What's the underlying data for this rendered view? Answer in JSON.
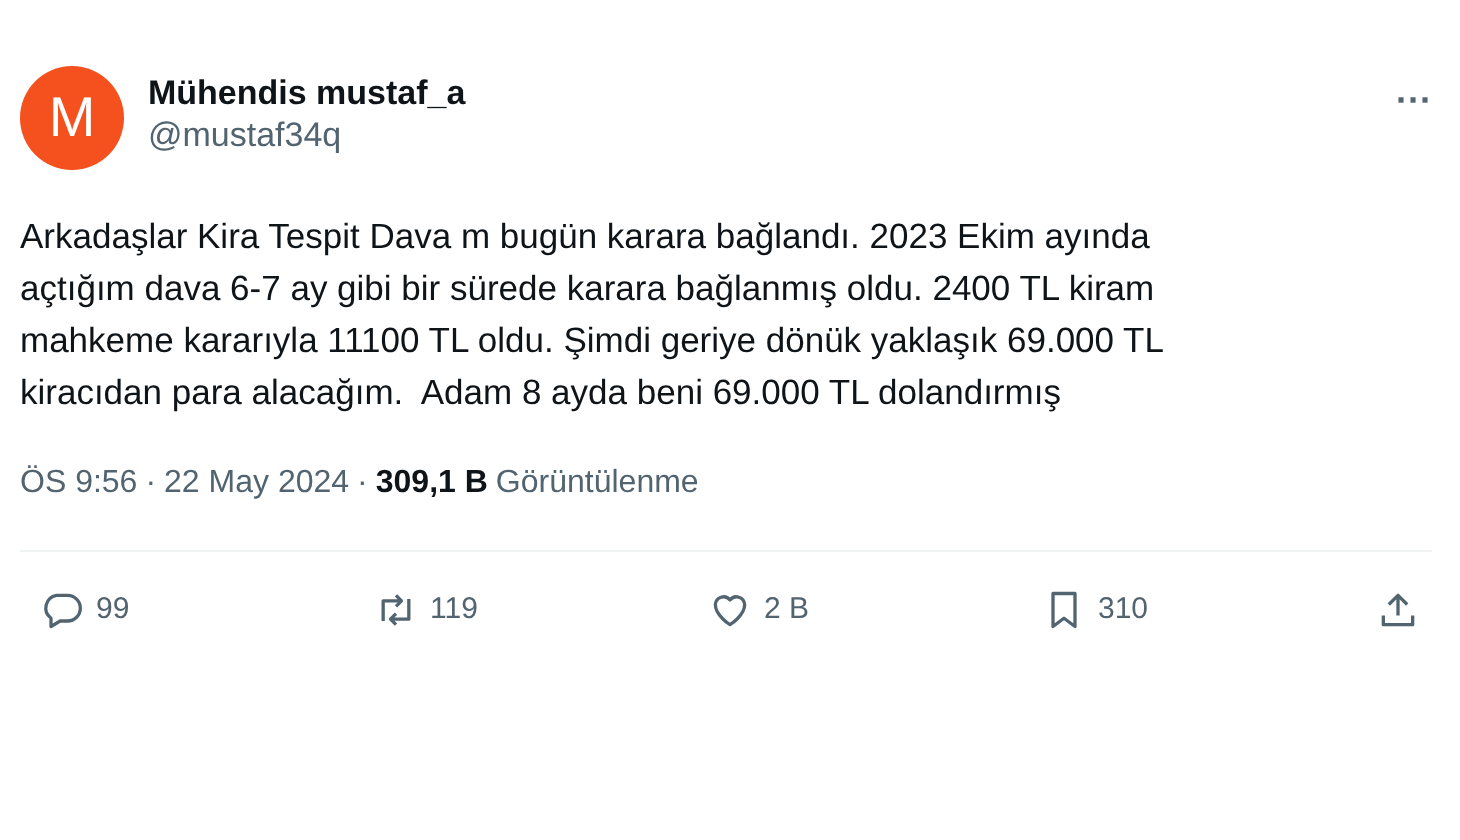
{
  "author": {
    "avatar_letter": "M",
    "name": "Mühendis mustaf_a",
    "handle": "@mustaf34q"
  },
  "more": "···",
  "text": "Arkadaşlar Kira Tespit Dava m bugün karara bağlandı. 2023 Ekim ayında\naçtığım dava 6-7 ay gibi bir sürede karara bağlanmış oldu. 2400 TL kiram\nmahkeme kararıyla 11100 TL oldu. Şimdi geriye dönük yaklaşık 69.000 TL\nkiracıdan para alacağım.  Adam 8 ayda beni 69.000 TL dolandırmış",
  "meta": {
    "time": "ÖS 9:56",
    "separator_1": "·",
    "date": "22 May 2024",
    "separator_2": "·",
    "views": "309,1 B",
    "views_label": "Görüntülenme"
  },
  "actions": [
    {
      "kind": "reply",
      "count": "99"
    },
    {
      "kind": "repost",
      "count": "119"
    },
    {
      "kind": "like",
      "count": "2 B"
    },
    {
      "kind": "bookmark",
      "count": "310"
    },
    {
      "kind": "share"
    }
  ]
}
